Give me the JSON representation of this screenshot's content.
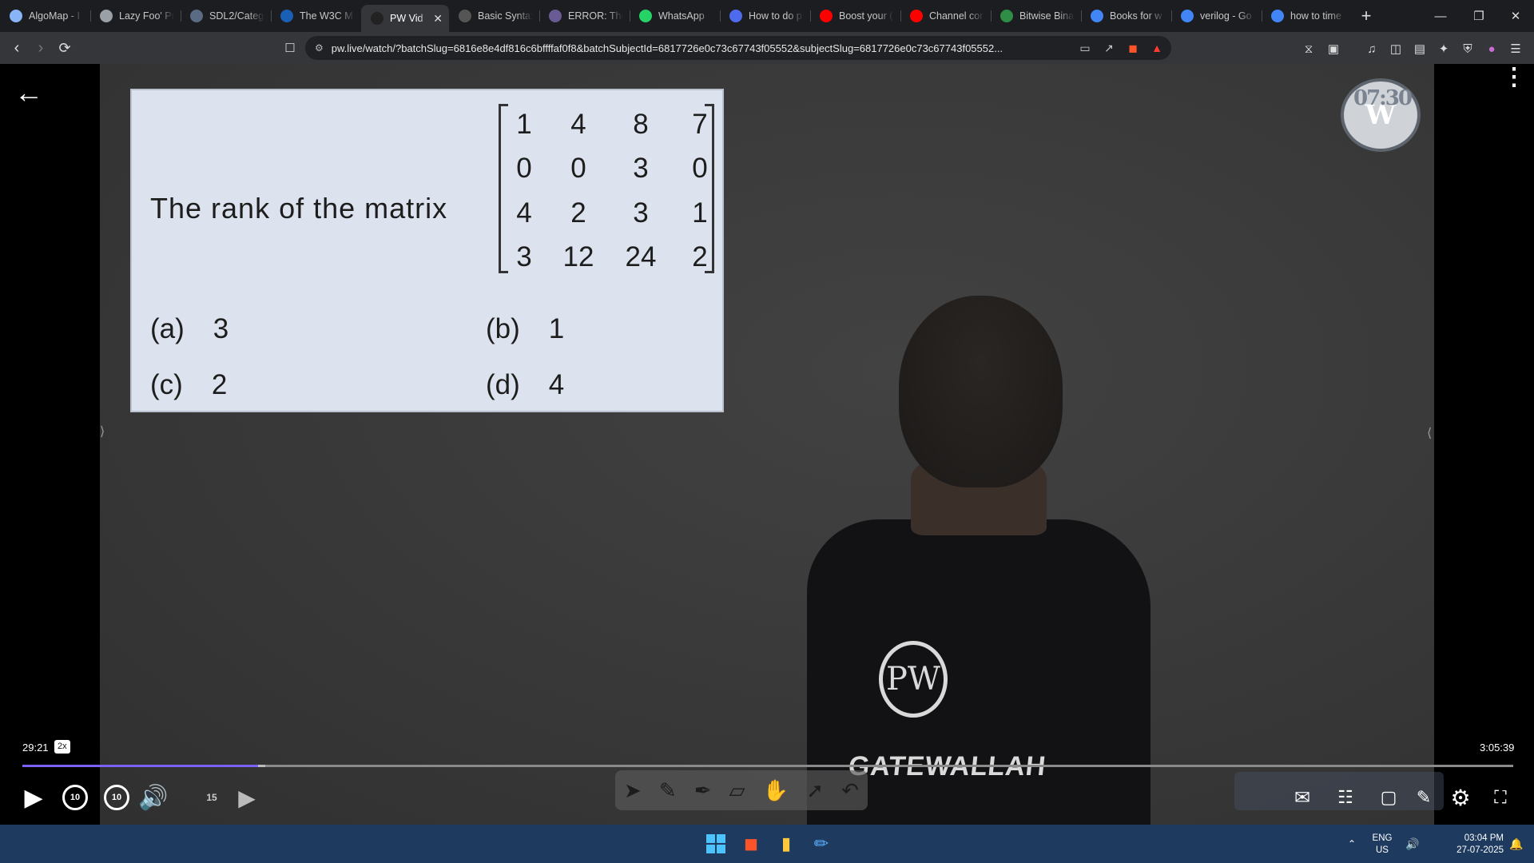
{
  "browser": {
    "tabs": [
      {
        "label": "AlgoMap - I",
        "favicon": "#8ab4f8",
        "icon": "algomap-icon"
      },
      {
        "label": "Lazy Foo' Pr",
        "favicon": "#9aa0a6",
        "icon": "globe-icon"
      },
      {
        "label": "SDL2/Categ",
        "favicon": "#5c6b84",
        "icon": "sdl-icon"
      },
      {
        "label": "The W3C M",
        "favicon": "#1a5fb4",
        "icon": "w3c-icon"
      },
      {
        "label": "PW Vid",
        "favicon": "#222222",
        "icon": "pw-icon",
        "active": true
      },
      {
        "label": "Basic Syntax",
        "favicon": "#555555",
        "icon": "doc-icon"
      },
      {
        "label": "ERROR: The",
        "favicon": "#6b5b95",
        "icon": "error-icon"
      },
      {
        "label": "WhatsApp",
        "favicon": "#25d366",
        "icon": "whatsapp-icon"
      },
      {
        "label": "How to do p",
        "favicon": "#4f6bed",
        "icon": "copilot-icon"
      },
      {
        "label": "Boost your (",
        "favicon": "#ff0000",
        "icon": "youtube-icon"
      },
      {
        "label": "Channel cor",
        "favicon": "#ff0000",
        "icon": "youtube-icon"
      },
      {
        "label": "Bitwise Bina",
        "favicon": "#2f8d46",
        "icon": "gfg-icon"
      },
      {
        "label": "Books for w",
        "favicon": "#4285f4",
        "icon": "google-icon"
      },
      {
        "label": "verilog - Go",
        "favicon": "#4285f4",
        "icon": "google-icon"
      },
      {
        "label": "how to time",
        "favicon": "#4285f4",
        "icon": "google-icon"
      }
    ],
    "new_tab": "+",
    "url": "pw.live/watch/?batchSlug=6816e8e4df816c6bffffaf0f8&batchSubjectId=6817726e0c73c67743f05552&subjectSlug=6817726e0c73c67743f05552..."
  },
  "video": {
    "question": "The rank of the matrix",
    "matrix": [
      [
        "1",
        "4",
        "8",
        "7"
      ],
      [
        "0",
        "0",
        "3",
        "0"
      ],
      [
        "4",
        "2",
        "3",
        "1"
      ],
      [
        "3",
        "12",
        "24",
        "2"
      ]
    ],
    "options": [
      {
        "key": "(a)",
        "value": "3"
      },
      {
        "key": "(b)",
        "value": "1"
      },
      {
        "key": "(c)",
        "value": "2"
      },
      {
        "key": "(d)",
        "value": "4"
      }
    ],
    "logo_overlay": "07:30",
    "logo_letters": "W",
    "shirt_text": "GATEWALLAH",
    "shirt_logo": "PW"
  },
  "player": {
    "current_time": "29:21",
    "speed": "2x",
    "duration": "3:05:39",
    "progress_fraction": 0.158,
    "skip_back": "10",
    "skip_forward": "10",
    "caption_counter": "15"
  },
  "taskbar": {
    "lang_top": "ENG",
    "lang_bottom": "US",
    "time": "03:04 PM",
    "date": "27-07-2025"
  }
}
